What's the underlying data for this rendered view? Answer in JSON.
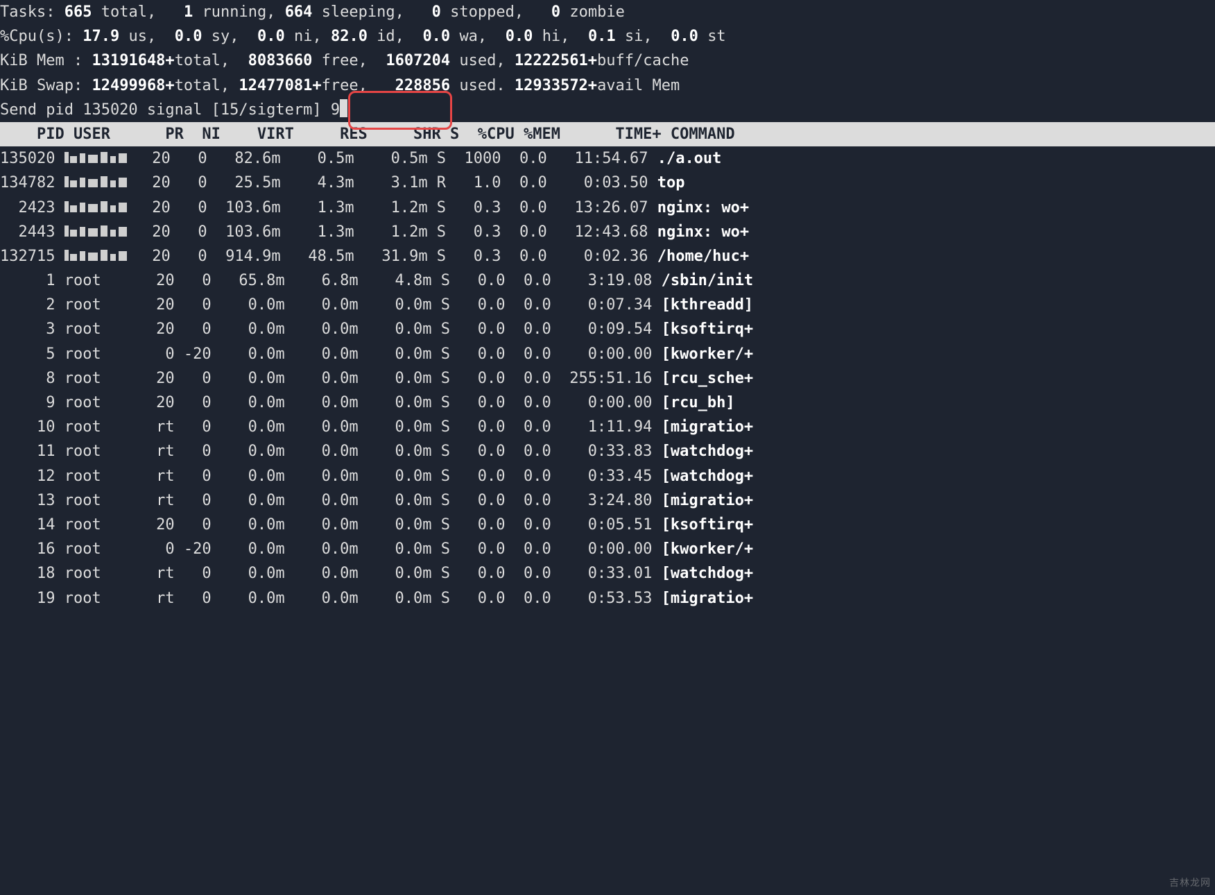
{
  "summary": {
    "tasks": {
      "label": "Tasks:",
      "total": "665",
      "total_label": "total,",
      "running": "1",
      "running_label": "running,",
      "sleeping": "664",
      "sleeping_label": "sleeping,",
      "stopped": "0",
      "stopped_label": "stopped,",
      "zombie": "0",
      "zombie_label": "zombie"
    },
    "cpu": {
      "label": "%Cpu(s):",
      "us": "17.9",
      "us_label": "us,",
      "sy": "0.0",
      "sy_label": "sy,",
      "ni": "0.0",
      "ni_label": "ni,",
      "id": "82.0",
      "id_label": "id,",
      "wa": "0.0",
      "wa_label": "wa,",
      "hi": "0.0",
      "hi_label": "hi,",
      "si": "0.1",
      "si_label": "si,",
      "st": "0.0",
      "st_label": "st"
    },
    "mem": {
      "label": "KiB Mem :",
      "total": "13191648+",
      "total_label": "total,",
      "free": "8083660",
      "free_label": "free,",
      "used": "1607204",
      "used_label": "used,",
      "buff": "12222561+",
      "buff_label": "buff/cache"
    },
    "swap": {
      "label": "KiB Swap:",
      "total": "12499968+",
      "total_label": "total,",
      "free": "12477081+",
      "free_label": "free,",
      "used": "228856",
      "used_label": "used.",
      "avail": "12933572+",
      "avail_label": "avail Mem"
    }
  },
  "prompt": {
    "prefix": "Send pid 135020 signal [15/sigterm] ",
    "value": "9"
  },
  "columns": [
    "PID",
    "USER",
    "PR",
    "NI",
    "VIRT",
    "RES",
    "SHR",
    "S",
    "%CPU",
    "%MEM",
    "TIME+",
    "COMMAND"
  ],
  "processes": [
    {
      "pid": "135020",
      "user_obscured": true,
      "pr": "20",
      "ni": "0",
      "virt": "82.6m",
      "res": "0.5m",
      "shr": "0.5m",
      "s": "S",
      "cpu": "1000",
      "mem": "0.0",
      "time": "11:54.67",
      "cmd": "./a.out"
    },
    {
      "pid": "134782",
      "user_obscured": true,
      "pr": "20",
      "ni": "0",
      "virt": "25.5m",
      "res": "4.3m",
      "shr": "3.1m",
      "s": "R",
      "cpu": "1.0",
      "mem": "0.0",
      "time": "0:03.50",
      "cmd": "top"
    },
    {
      "pid": "2423",
      "user_obscured": true,
      "pr": "20",
      "ni": "0",
      "virt": "103.6m",
      "res": "1.3m",
      "shr": "1.2m",
      "s": "S",
      "cpu": "0.3",
      "mem": "0.0",
      "time": "13:26.07",
      "cmd": "nginx: wo+"
    },
    {
      "pid": "2443",
      "user_obscured": true,
      "pr": "20",
      "ni": "0",
      "virt": "103.6m",
      "res": "1.3m",
      "shr": "1.2m",
      "s": "S",
      "cpu": "0.3",
      "mem": "0.0",
      "time": "12:43.68",
      "cmd": "nginx: wo+"
    },
    {
      "pid": "132715",
      "user_obscured": true,
      "pr": "20",
      "ni": "0",
      "virt": "914.9m",
      "res": "48.5m",
      "shr": "31.9m",
      "s": "S",
      "cpu": "0.3",
      "mem": "0.0",
      "time": "0:02.36",
      "cmd": "/home/huc+"
    },
    {
      "pid": "1",
      "user": "root",
      "pr": "20",
      "ni": "0",
      "virt": "65.8m",
      "res": "6.8m",
      "shr": "4.8m",
      "s": "S",
      "cpu": "0.0",
      "mem": "0.0",
      "time": "3:19.08",
      "cmd": "/sbin/init"
    },
    {
      "pid": "2",
      "user": "root",
      "pr": "20",
      "ni": "0",
      "virt": "0.0m",
      "res": "0.0m",
      "shr": "0.0m",
      "s": "S",
      "cpu": "0.0",
      "mem": "0.0",
      "time": "0:07.34",
      "cmd": "[kthreadd]"
    },
    {
      "pid": "3",
      "user": "root",
      "pr": "20",
      "ni": "0",
      "virt": "0.0m",
      "res": "0.0m",
      "shr": "0.0m",
      "s": "S",
      "cpu": "0.0",
      "mem": "0.0",
      "time": "0:09.54",
      "cmd": "[ksoftirq+"
    },
    {
      "pid": "5",
      "user": "root",
      "pr": "0",
      "ni": "-20",
      "virt": "0.0m",
      "res": "0.0m",
      "shr": "0.0m",
      "s": "S",
      "cpu": "0.0",
      "mem": "0.0",
      "time": "0:00.00",
      "cmd": "[kworker/+"
    },
    {
      "pid": "8",
      "user": "root",
      "pr": "20",
      "ni": "0",
      "virt": "0.0m",
      "res": "0.0m",
      "shr": "0.0m",
      "s": "S",
      "cpu": "0.0",
      "mem": "0.0",
      "time": "255:51.16",
      "cmd": "[rcu_sche+"
    },
    {
      "pid": "9",
      "user": "root",
      "pr": "20",
      "ni": "0",
      "virt": "0.0m",
      "res": "0.0m",
      "shr": "0.0m",
      "s": "S",
      "cpu": "0.0",
      "mem": "0.0",
      "time": "0:00.00",
      "cmd": "[rcu_bh]"
    },
    {
      "pid": "10",
      "user": "root",
      "pr": "rt",
      "ni": "0",
      "virt": "0.0m",
      "res": "0.0m",
      "shr": "0.0m",
      "s": "S",
      "cpu": "0.0",
      "mem": "0.0",
      "time": "1:11.94",
      "cmd": "[migratio+"
    },
    {
      "pid": "11",
      "user": "root",
      "pr": "rt",
      "ni": "0",
      "virt": "0.0m",
      "res": "0.0m",
      "shr": "0.0m",
      "s": "S",
      "cpu": "0.0",
      "mem": "0.0",
      "time": "0:33.83",
      "cmd": "[watchdog+"
    },
    {
      "pid": "12",
      "user": "root",
      "pr": "rt",
      "ni": "0",
      "virt": "0.0m",
      "res": "0.0m",
      "shr": "0.0m",
      "s": "S",
      "cpu": "0.0",
      "mem": "0.0",
      "time": "0:33.45",
      "cmd": "[watchdog+"
    },
    {
      "pid": "13",
      "user": "root",
      "pr": "rt",
      "ni": "0",
      "virt": "0.0m",
      "res": "0.0m",
      "shr": "0.0m",
      "s": "S",
      "cpu": "0.0",
      "mem": "0.0",
      "time": "3:24.80",
      "cmd": "[migratio+"
    },
    {
      "pid": "14",
      "user": "root",
      "pr": "20",
      "ni": "0",
      "virt": "0.0m",
      "res": "0.0m",
      "shr": "0.0m",
      "s": "S",
      "cpu": "0.0",
      "mem": "0.0",
      "time": "0:05.51",
      "cmd": "[ksoftirq+"
    },
    {
      "pid": "16",
      "user": "root",
      "pr": "0",
      "ni": "-20",
      "virt": "0.0m",
      "res": "0.0m",
      "shr": "0.0m",
      "s": "S",
      "cpu": "0.0",
      "mem": "0.0",
      "time": "0:00.00",
      "cmd": "[kworker/+"
    },
    {
      "pid": "18",
      "user": "root",
      "pr": "rt",
      "ni": "0",
      "virt": "0.0m",
      "res": "0.0m",
      "shr": "0.0m",
      "s": "S",
      "cpu": "0.0",
      "mem": "0.0",
      "time": "0:33.01",
      "cmd": "[watchdog+"
    },
    {
      "pid": "19",
      "user": "root",
      "pr": "rt",
      "ni": "0",
      "virt": "0.0m",
      "res": "0.0m",
      "shr": "0.0m",
      "s": "S",
      "cpu": "0.0",
      "mem": "0.0",
      "time": "0:53.53",
      "cmd": "[migratio+"
    }
  ],
  "watermark": "吉林龙网"
}
